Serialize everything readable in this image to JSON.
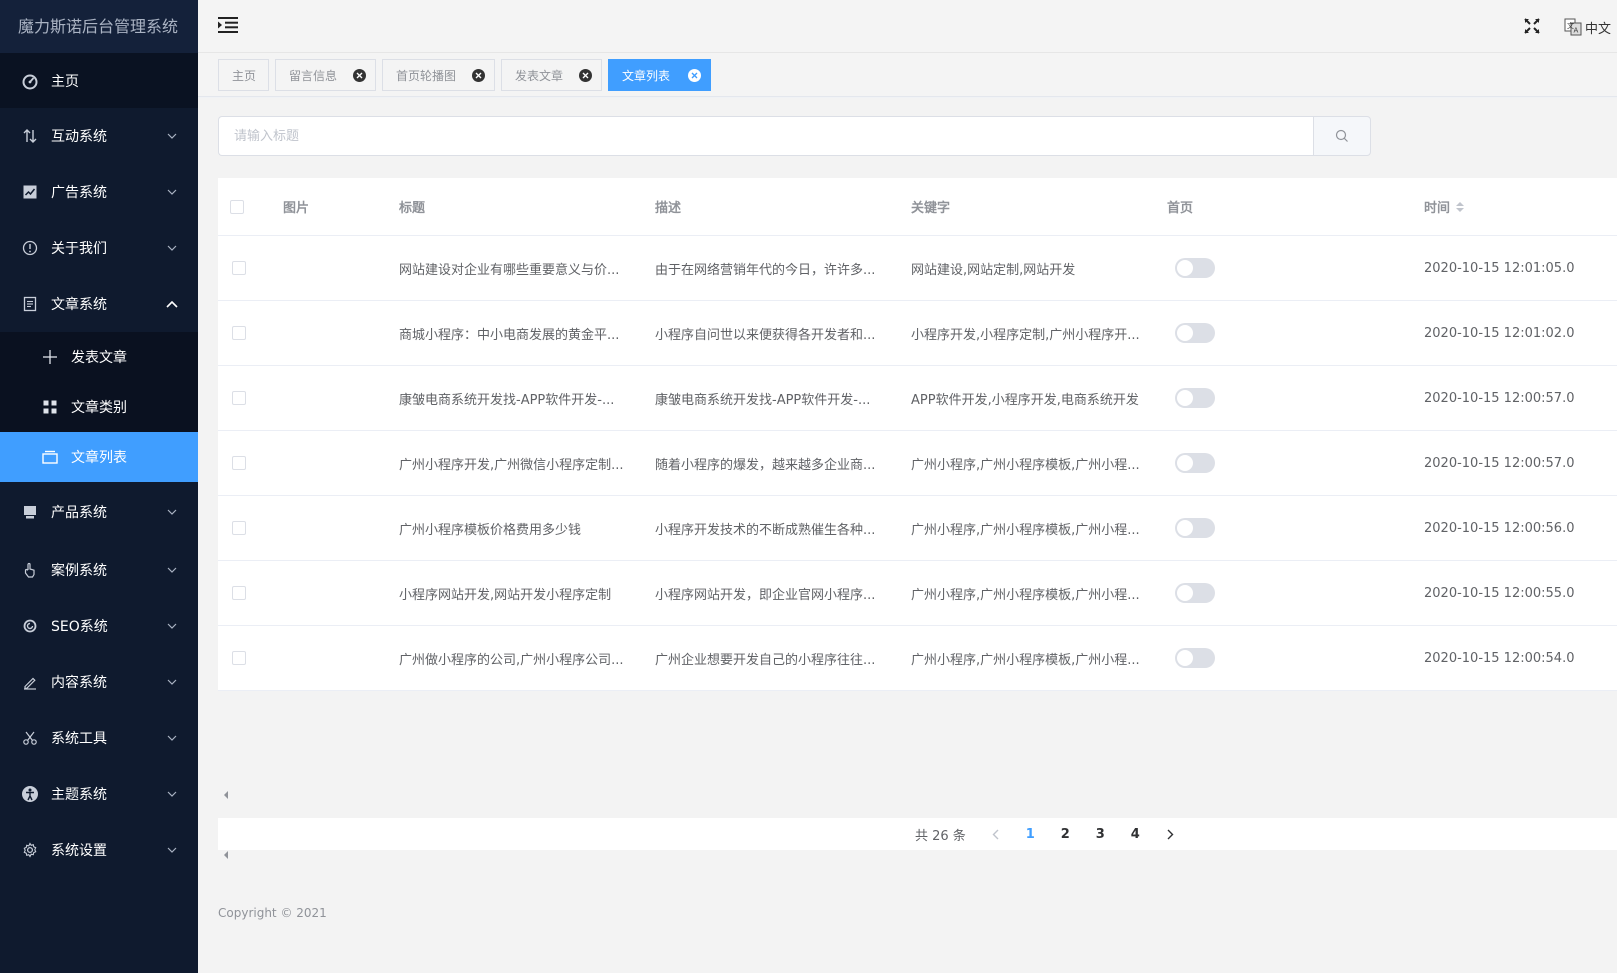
{
  "sidebar": {
    "brand": "魔力斯诺后台管理系统",
    "home": {
      "label": "主页",
      "icon": "dashboard-icon"
    },
    "items": [
      {
        "label": "互动系统",
        "icon": "interaction-icon"
      },
      {
        "label": "广告系统",
        "icon": "chart-icon"
      },
      {
        "label": "关于我们",
        "icon": "info-icon"
      },
      {
        "label": "文章系统",
        "icon": "document-icon",
        "expanded": true
      },
      {
        "label": "产品系统",
        "icon": "product-icon"
      },
      {
        "label": "案例系统",
        "icon": "hand-icon"
      },
      {
        "label": "SEO系统",
        "icon": "seo-icon"
      },
      {
        "label": "内容系统",
        "icon": "edit-icon"
      },
      {
        "label": "系统工具",
        "icon": "scissors-icon"
      },
      {
        "label": "主题系统",
        "icon": "theme-icon"
      },
      {
        "label": "系统设置",
        "icon": "gear-icon"
      }
    ],
    "submenu": [
      {
        "label": "发表文章",
        "icon": "plus-icon"
      },
      {
        "label": "文章类别",
        "icon": "grid-icon"
      },
      {
        "label": "文章列表",
        "icon": "list-icon",
        "active": true
      }
    ]
  },
  "header": {
    "lang": "中文"
  },
  "tabs": [
    {
      "label": "主页",
      "closable": false
    },
    {
      "label": "留言信息",
      "closable": true
    },
    {
      "label": "首页轮播图",
      "closable": true
    },
    {
      "label": "发表文章",
      "closable": true
    },
    {
      "label": "文章列表",
      "closable": true,
      "active": true
    }
  ],
  "search": {
    "placeholder": "请输入标题",
    "value": ""
  },
  "table": {
    "columns": [
      "图片",
      "标题",
      "描述",
      "关键字",
      "首页",
      "时间"
    ],
    "rows": [
      {
        "title": "网站建设对企业有哪些重要意义与价...",
        "desc": "由于在网络营销年代的今日，许许多...",
        "keywords": "网站建设,网站定制,网站开发",
        "home": false,
        "time": "2020-10-15 12:01:05.0"
      },
      {
        "title": "商城小程序：中小电商发展的黄金平...",
        "desc": "小程序自问世以来便获得各开发者和...",
        "keywords": "小程序开发,小程序定制,广州小程序开...",
        "home": false,
        "time": "2020-10-15 12:01:02.0"
      },
      {
        "title": "康皱电商系统开发找-APP软件开发-...",
        "desc": "康皱电商系统开发找-APP软件开发-...",
        "keywords": "APP软件开发,小程序开发,电商系统开发",
        "home": false,
        "time": "2020-10-15 12:00:57.0"
      },
      {
        "title": "广州小程序开发,广州微信小程序定制...",
        "desc": "随着小程序的爆发，越来越多企业商...",
        "keywords": "广州小程序,广州小程序模板,广州小程...",
        "home": false,
        "time": "2020-10-15 12:00:57.0"
      },
      {
        "title": "广州小程序模板价格费用多少钱",
        "desc": "小程序开发技术的不断成熟催生各种...",
        "keywords": "广州小程序,广州小程序模板,广州小程...",
        "home": false,
        "time": "2020-10-15 12:00:56.0"
      },
      {
        "title": "小程序网站开发,网站开发小程序定制",
        "desc": "小程序网站开发，即企业官网小程序...",
        "keywords": "广州小程序,广州小程序模板,广州小程...",
        "home": false,
        "time": "2020-10-15 12:00:55.0"
      },
      {
        "title": "广州做小程序的公司,广州小程序公司...",
        "desc": "广州企业想要开发自己的小程序往往...",
        "keywords": "广州小程序,广州小程序模板,广州小程...",
        "home": false,
        "time": "2020-10-15 12:00:54.0"
      }
    ]
  },
  "pagination": {
    "total": "共 26 条",
    "pages": [
      "1",
      "2",
      "3",
      "4"
    ],
    "current": "1"
  },
  "footer": {
    "copyright": "Copyright © 2021"
  },
  "colors": {
    "sidebar": "#0f1a2e",
    "accent": "#409eff"
  }
}
